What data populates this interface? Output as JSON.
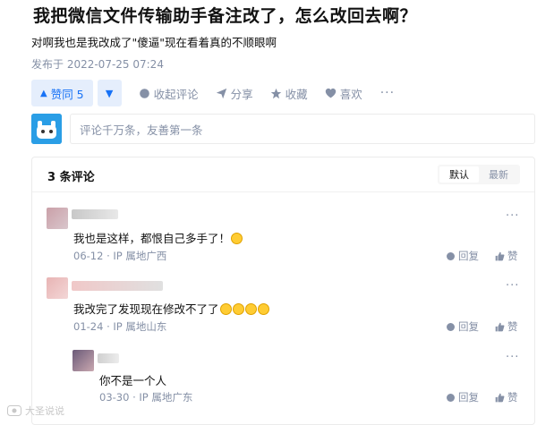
{
  "question": {
    "title": "我把微信文件传输助手备注改了，怎么改回去啊？"
  },
  "answer": {
    "text": "对啊我也是我改成了\"傻逼\"现在看着真的不顺眼啊",
    "published": "发布于 2022-07-25 07:24"
  },
  "actions": {
    "vote_up": "赞同 5",
    "collapse_comments": "收起评论",
    "share": "分享",
    "favorite": "收藏",
    "like": "喜欢",
    "more": "···"
  },
  "comment_box": {
    "placeholder": "评论千万条，友善第一条"
  },
  "comments_panel": {
    "count_label": "3 条评论",
    "sort_default": "默认",
    "sort_latest": "最新"
  },
  "comments": [
    {
      "text": "我也是这样，都恨自己多手了！",
      "date": "06-12",
      "ip": "IP 属地广西",
      "reply": "回复",
      "like": "赞",
      "more": "···"
    },
    {
      "text": "我改完了发现现在修改不了了",
      "date": "01-24",
      "ip": "IP 属地山东",
      "reply": "回复",
      "like": "赞",
      "more": "···"
    },
    {
      "text": "你不是一个人",
      "date": "03-30",
      "ip": "IP 属地广东",
      "reply": "回复",
      "like": "赞",
      "more": "···"
    }
  ],
  "watermark": {
    "text": "大圣说说"
  },
  "colors": {
    "accent": "#1772f6",
    "accent_bg": "#e5eefc",
    "muted": "#8590a6"
  }
}
